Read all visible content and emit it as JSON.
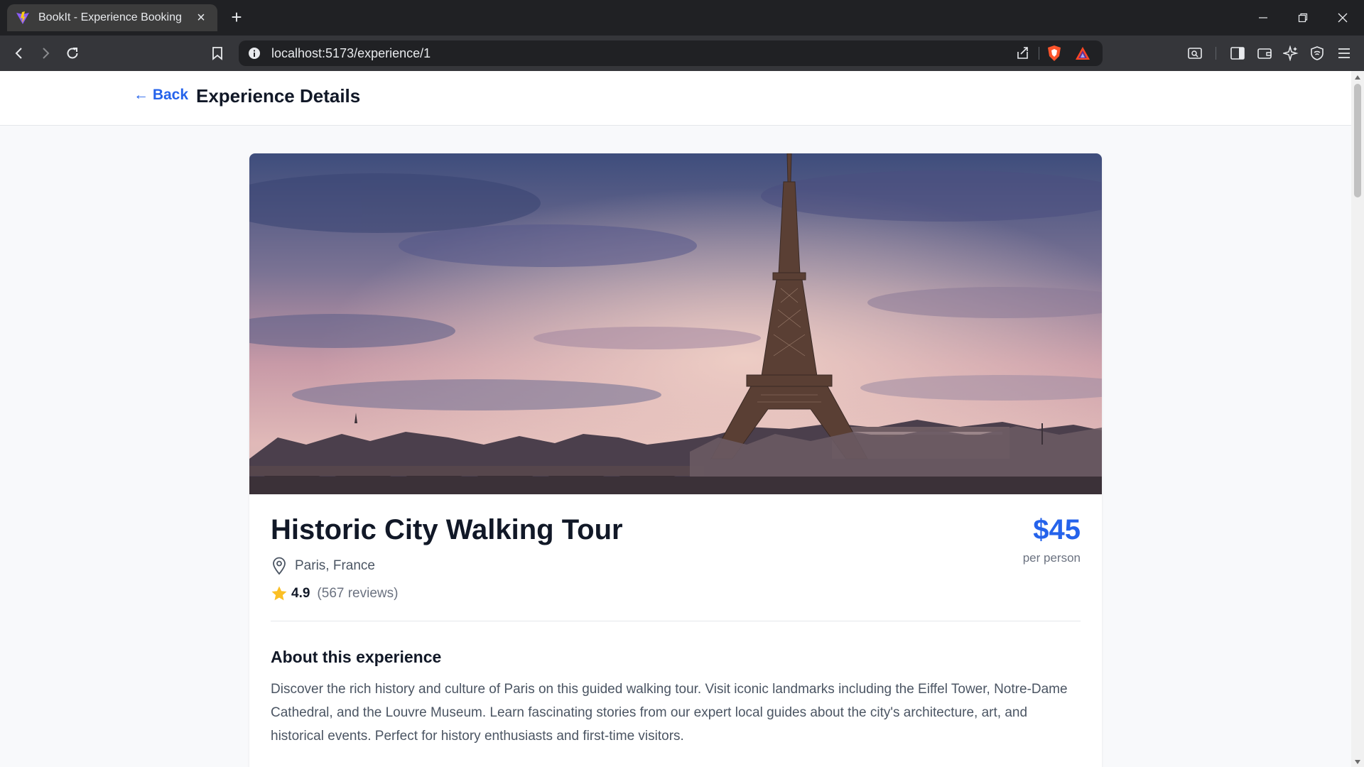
{
  "browser": {
    "tab": {
      "title": "BookIt - Experience Booking",
      "favicon": "vite-icon",
      "close_label": "×"
    },
    "new_tab_label": "+",
    "url": {
      "host": "localhost",
      "path": ":5173/experience/1"
    },
    "icons": [
      "back-icon",
      "forward-icon",
      "reload-icon",
      "bookmark-icon",
      "site-info-icon",
      "share-icon",
      "brave-shield-icon",
      "brave-rewards-icon",
      "search-tabs-icon",
      "sidebar-icon",
      "wallet-icon",
      "leo-ai-icon",
      "vpn-icon",
      "menu-icon"
    ]
  },
  "header": {
    "back_label": "← Back",
    "title": "Experience Details"
  },
  "experience": {
    "title": "Historic City Walking Tour",
    "price": "$45",
    "price_unit": "per person",
    "location": "Paris, France",
    "rating": "4.9",
    "reviews": "(567 reviews)",
    "about_heading": "About this experience",
    "description": "Discover the rich history and culture of Paris on this guided walking tour. Visit iconic landmarks including the Eiffel Tower, Notre-Dame Cathedral, and the Louvre Museum. Learn fascinating stories from our expert local guides about the city's architecture, art, and historical events. Perfect for history enthusiasts and first-time visitors.",
    "image": "eiffel-tower-photo"
  },
  "colors": {
    "accent": "#2563eb",
    "star": "#fbbf24",
    "page_bg": "#f8f9fb"
  }
}
